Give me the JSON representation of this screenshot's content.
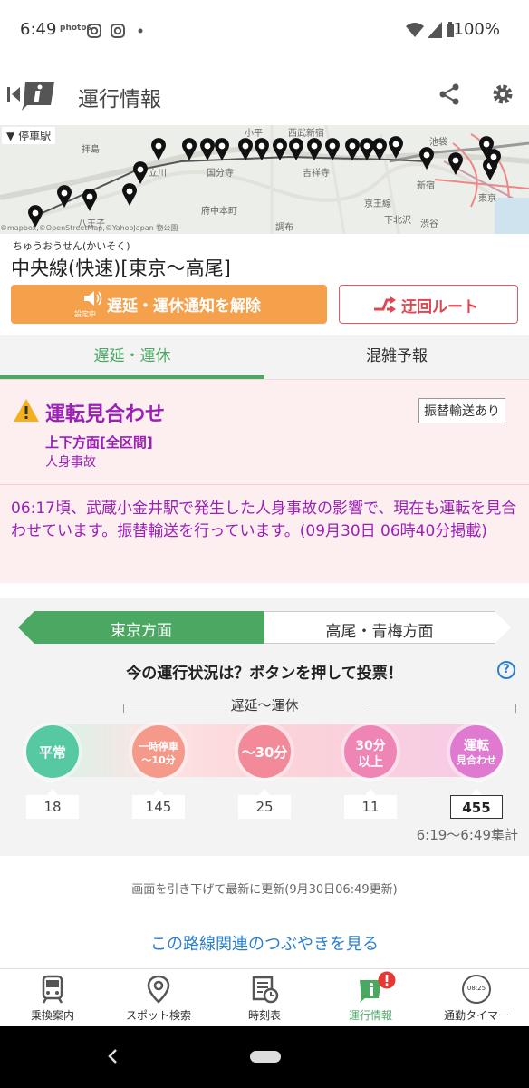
{
  "status_bar": {
    "time": "6:49",
    "photos_label": "photos",
    "battery": "100%"
  },
  "app_bar": {
    "title": "運行情報",
    "icons": [
      "back-info-icon",
      "share-icon",
      "gear-icon"
    ]
  },
  "map": {
    "stop_chip": "停車駅",
    "labels": [
      "拝島",
      "立川",
      "国分寺",
      "府中本町",
      "八王子",
      "西武新宿",
      "吉祥寺",
      "調布",
      "京王線",
      "下北沢",
      "渋谷",
      "新宿",
      "池袋",
      "東京",
      "小平"
    ],
    "attribution": "©mapbox,©OpenStreetMap,©YahooJapan 物公園"
  },
  "route": {
    "kana": "ちゅうおうせん(かいそく)",
    "name": "中央線(快速)[東京〜高尾]"
  },
  "buttons": {
    "notify_label": "遅延・運休通知を解除",
    "notify_sub": "設定中",
    "detour_label": "迂回ルート"
  },
  "tabs": {
    "active": "遅延・運休",
    "other": "混雑予報"
  },
  "alert": {
    "headline": "運転見合わせ",
    "badge": "振替輸送あり",
    "direction": "上下方面[全区間]",
    "cause": "人身事故",
    "message": "06:17頃、武蔵小金井駅で発生した人身事故の影響で、現在も運転を見合わせています。振替輸送を行っています。(09月30日 06時40分掲載)"
  },
  "directions": {
    "left": "東京方面",
    "right": "高尾・青梅方面"
  },
  "vote": {
    "question": "今の運行状況は？ボタンを押して投票！",
    "help": "?",
    "range_label": "遅延〜運休",
    "options": [
      {
        "line1": "平常",
        "line2": "",
        "count": "18",
        "color": "#56c9a2"
      },
      {
        "line1": "一時停車",
        "line2": "〜10分",
        "count": "145",
        "color": "#f59a8a"
      },
      {
        "line1": "〜30分",
        "line2": "",
        "count": "25",
        "color": "#f28a9a"
      },
      {
        "line1": "30分",
        "line2": "以上",
        "count": "11",
        "color": "#ef85b4"
      },
      {
        "line1": "運転",
        "line2": "見合わせ",
        "count": "455",
        "color": "#e07ad0"
      }
    ],
    "selected_index": 4,
    "aggregate": "6:19〜6:49集計"
  },
  "refresh_note": "画面を引き下げて最新に更新(9月30日06:49更新)",
  "tweets_link": "この路線関連のつぶやきを見る",
  "bottom_nav": [
    {
      "label": "乗換案内",
      "icon": "train-icon"
    },
    {
      "label": "スポット検索",
      "icon": "map-pin-icon"
    },
    {
      "label": "時刻表",
      "icon": "timetable-icon"
    },
    {
      "label": "運行情報",
      "icon": "info-alert-icon",
      "active": true
    },
    {
      "label": "通勤タイマー",
      "icon": "timer-icon",
      "timer_text": "08:25"
    }
  ],
  "colors": {
    "accent_green": "#4aa862",
    "alert_purple": "#9b1fb8",
    "orange": "#f5a04b",
    "red": "#e04550",
    "link_blue": "#2b7fd0"
  }
}
